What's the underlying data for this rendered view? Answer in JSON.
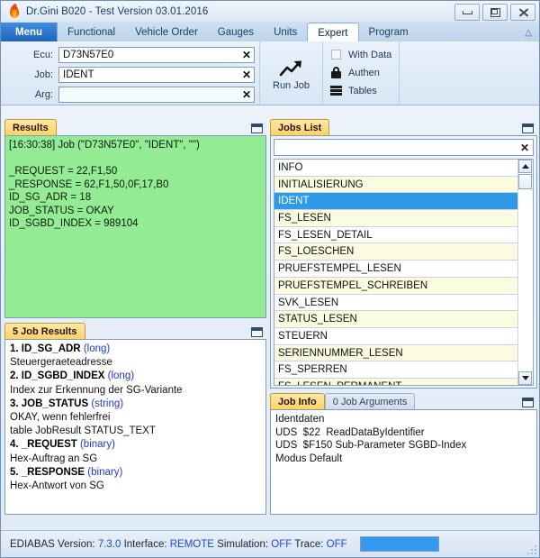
{
  "window": {
    "title": "Dr.Gini B020 - Test Version 03.01.2016",
    "icon": "flame-icon",
    "minimize_label": "Minimize",
    "maximize_label": "Restore",
    "close_label": "Close"
  },
  "ribbon": {
    "menu_label": "Menu",
    "tabs": [
      {
        "label": "Functional",
        "active": false
      },
      {
        "label": "Vehicle Order",
        "active": false
      },
      {
        "label": "Gauges",
        "active": false
      },
      {
        "label": "Units",
        "active": false
      },
      {
        "label": "Expert",
        "active": true
      },
      {
        "label": "Program",
        "active": false
      }
    ],
    "collapse_icon": "chevron-up-icon",
    "fields": [
      {
        "label": "Ecu:",
        "value": "D73N57E0",
        "clear": "✕"
      },
      {
        "label": "Job:",
        "value": "IDENT",
        "clear": "✕"
      },
      {
        "label": "Arg:",
        "value": "",
        "clear": "✕"
      }
    ],
    "run_job": {
      "label": "Run Job",
      "icon": "trending-up-arrow-icon"
    },
    "options": [
      {
        "label": "With Data",
        "icon": "checkbox-empty-icon",
        "checked": false
      },
      {
        "label": "Authen",
        "icon": "lock-icon"
      },
      {
        "label": "Tables",
        "icon": "table-rows-icon"
      }
    ]
  },
  "results_panel": {
    "tab_label": "Results",
    "restore_icon": "restore-window-icon",
    "text": "[16:30:38] Job (\"D73N57E0\", \"IDENT\", \"\")\n\n_REQUEST = 22,F1,50\n_RESPONSE = 62,F1,50,0F,17,B0\nID_SG_ADR = 18\nJOB_STATUS = OKAY\nID_SGBD_INDEX = 989104"
  },
  "job_results_panel": {
    "tab_label": "5 Job Results",
    "restore_icon": "restore-window-icon",
    "entries": [
      {
        "index": "1.",
        "name": "ID_SG_ADR",
        "type": "(long)",
        "desc": [
          "Steuergeraeteadresse"
        ]
      },
      {
        "index": "2.",
        "name": "ID_SGBD_INDEX",
        "type": "(long)",
        "desc": [
          "Index zur Erkennung der SG-Variante"
        ]
      },
      {
        "index": "3.",
        "name": "JOB_STATUS",
        "type": "(string)",
        "desc": [
          "OKAY, wenn fehlerfrei",
          "table JobResult STATUS_TEXT"
        ]
      },
      {
        "index": "4.",
        "name": "_REQUEST",
        "type": "(binary)",
        "desc": [
          "Hex-Auftrag an SG"
        ]
      },
      {
        "index": "5.",
        "name": "_RESPONSE",
        "type": "(binary)",
        "desc": [
          "Hex-Antwort von SG"
        ]
      }
    ]
  },
  "jobs_list_panel": {
    "tab_label": "Jobs List",
    "restore_icon": "restore-window-icon",
    "filter": {
      "value": "",
      "placeholder": "",
      "clear": "✕"
    },
    "scroll": {
      "up_icon": "arrow-up-icon",
      "down_icon": "arrow-down-icon"
    },
    "items": [
      {
        "label": "INFO",
        "selected": false
      },
      {
        "label": "INITIALISIERUNG",
        "selected": false
      },
      {
        "label": "IDENT",
        "selected": true
      },
      {
        "label": "FS_LESEN",
        "selected": false
      },
      {
        "label": "FS_LESEN_DETAIL",
        "selected": false
      },
      {
        "label": "FS_LOESCHEN",
        "selected": false
      },
      {
        "label": "PRUEFSTEMPEL_LESEN",
        "selected": false
      },
      {
        "label": "PRUEFSTEMPEL_SCHREIBEN",
        "selected": false
      },
      {
        "label": "SVK_LESEN",
        "selected": false
      },
      {
        "label": "STATUS_LESEN",
        "selected": false
      },
      {
        "label": "STEUERN",
        "selected": false
      },
      {
        "label": "SERIENNUMMER_LESEN",
        "selected": false
      },
      {
        "label": "FS_SPERREN",
        "selected": false
      },
      {
        "label": "FS_LESEN_PERMANENT",
        "selected": false
      }
    ]
  },
  "job_info_panel": {
    "tab_label": "Job Info",
    "tab2_label": "0 Job Arguments",
    "restore_icon": "restore-window-icon",
    "text": "Identdaten\nUDS  $22  ReadDataByIdentifier\nUDS  $F150 Sub-Parameter SGBD-Index\nModus Default"
  },
  "statusbar": {
    "ediabas_label": "EDIABAS Version:",
    "ediabas_value": "7.3.0",
    "interface_label": "Interface:",
    "interface_value": "REMOTE",
    "simulation_label": "Simulation:",
    "simulation_value": "OFF",
    "trace_label": "Trace:",
    "trace_value": "OFF",
    "progress_color": "#3399f3",
    "resize_grip": "resize-grip-icon"
  }
}
